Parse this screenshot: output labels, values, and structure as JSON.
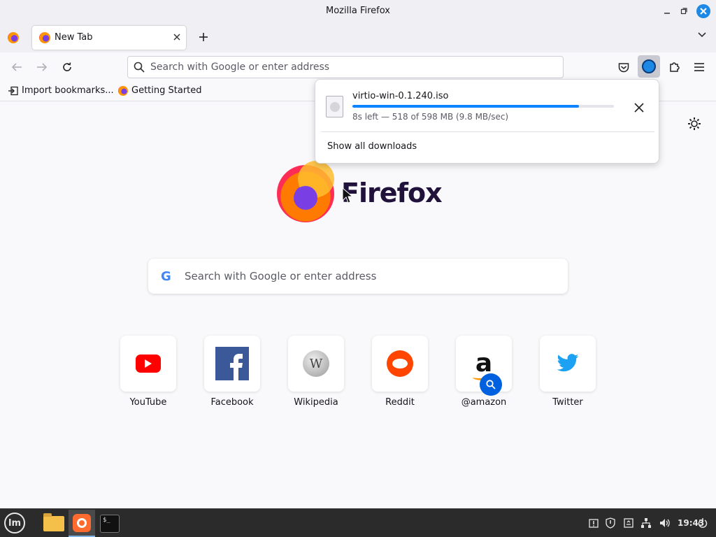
{
  "window": {
    "title": "Mozilla Firefox"
  },
  "tabs": [
    {
      "label": "New Tab",
      "active": true
    }
  ],
  "navbar": {
    "url_placeholder": "Search with Google or enter address"
  },
  "bookmarks": [
    {
      "label": "Import bookmarks...",
      "icon": "import-icon"
    },
    {
      "label": "Getting Started",
      "icon": "firefox-icon"
    }
  ],
  "downloads_panel": {
    "file_name": "virtio-win-0.1.240.iso",
    "status": "8s left — 518 of 598 MB (9.8 MB/sec)",
    "progress_fraction": 0.866,
    "show_all_label": "Show all downloads"
  },
  "newtab": {
    "brand": "Firefox",
    "search_placeholder": "Search with Google or enter address",
    "google_letter": "G",
    "shortcuts": [
      {
        "label": "YouTube",
        "icon": "youtube-icon"
      },
      {
        "label": "Facebook",
        "icon": "facebook-icon"
      },
      {
        "label": "Wikipedia",
        "icon": "wikipedia-icon"
      },
      {
        "label": "Reddit",
        "icon": "reddit-icon"
      },
      {
        "label": "@amazon",
        "icon": "amazon-icon"
      },
      {
        "label": "Twitter",
        "icon": "twitter-icon"
      }
    ]
  },
  "taskbar": {
    "clock": "19:43",
    "mint_logo": "lm"
  },
  "colors": {
    "accent": "#0a84ff",
    "download_button_bg": "#c9c9d1",
    "taskbar_bg": "#2b2b2b"
  }
}
